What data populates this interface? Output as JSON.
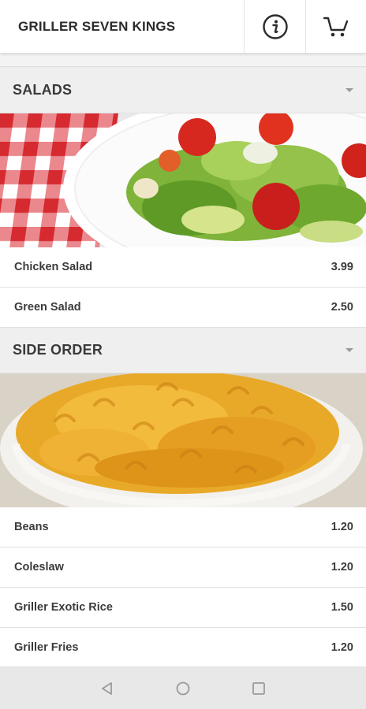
{
  "app": {
    "title": "GRILLER SEVEN KINGS",
    "accent_color": "#2b2b2b",
    "icons": [
      "info-icon",
      "cart-icon"
    ]
  },
  "sections": [
    {
      "label": "SALADS",
      "image": "salad-image",
      "items": [
        {
          "name": "Chicken Salad",
          "price": "3.99"
        },
        {
          "name": "Green Salad",
          "price": "2.50"
        }
      ]
    },
    {
      "label": "SIDE ORDER",
      "image": "mac-and-cheese-image",
      "items": [
        {
          "name": "Beans",
          "price": "1.20"
        },
        {
          "name": "Coleslaw",
          "price": "1.20"
        },
        {
          "name": "Griller Exotic Rice",
          "price": "1.50"
        },
        {
          "name": "Griller Fries",
          "price": "1.20"
        }
      ]
    }
  ],
  "system_nav": {
    "icons": [
      "back-icon",
      "home-icon",
      "recents-icon"
    ]
  }
}
